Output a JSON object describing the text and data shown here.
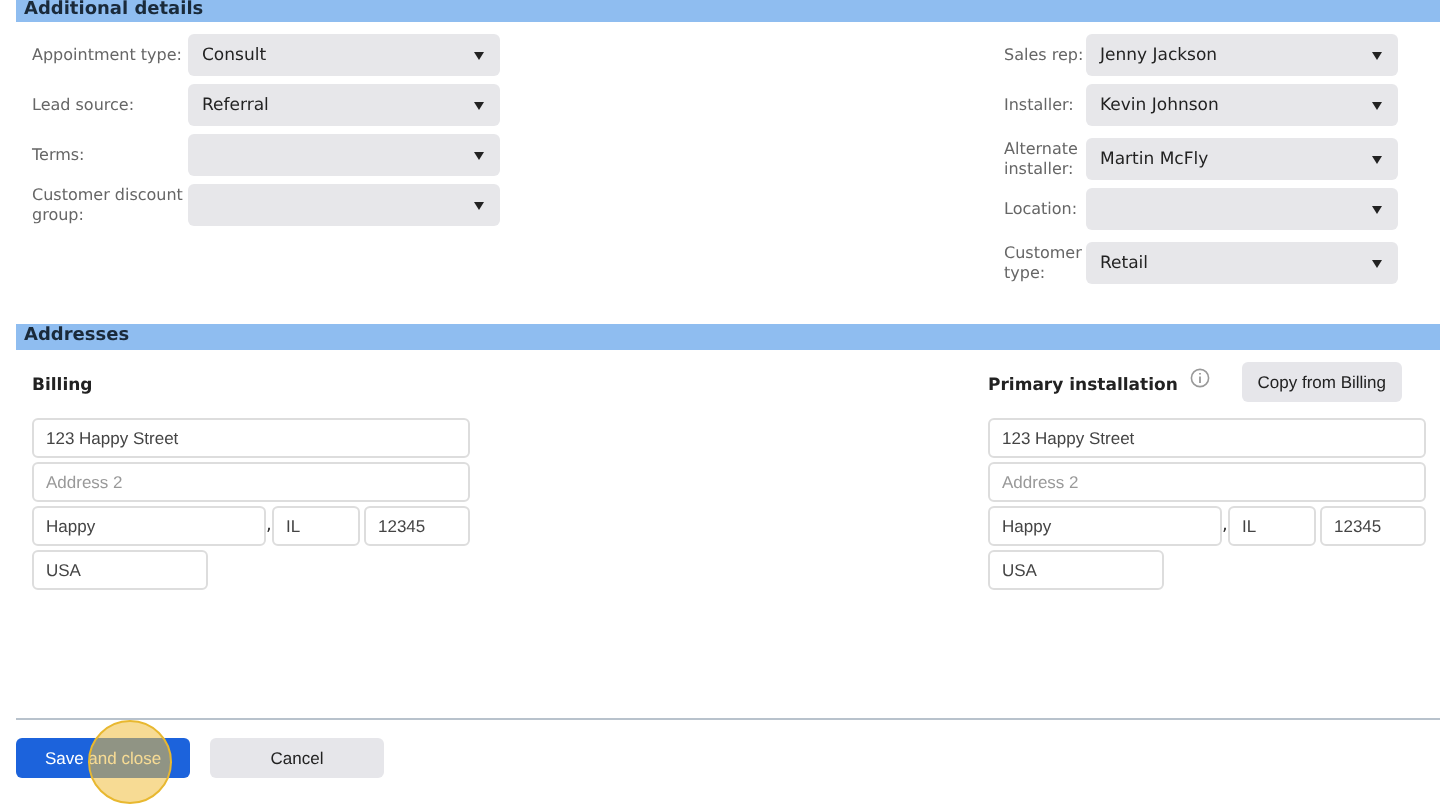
{
  "details_section": {
    "title": "Additional details",
    "left_fields": [
      {
        "label": "Appointment type:",
        "value": "Consult"
      },
      {
        "label": "Lead source:",
        "value": "Referral"
      },
      {
        "label": "Terms:"
      },
      {
        "label": "Customer discount group:"
      }
    ],
    "right_fields": [
      {
        "label": "Sales rep:",
        "value": "Jenny Jackson"
      },
      {
        "label": "Installer:",
        "value": "Kevin Johnson"
      },
      {
        "label": "Alternate installer:",
        "value": "Martin McFly"
      },
      {
        "label": "Location:"
      },
      {
        "label": "Customer type:",
        "value": "Retail"
      }
    ]
  },
  "addresses_section": {
    "title": "Addresses",
    "billing": {
      "title": "Billing",
      "street": "123 Happy Street",
      "address2_placeholder": "Address 2",
      "city": "Happy",
      "separator": ",",
      "state": "IL",
      "zip": "12345",
      "country": "USA"
    },
    "installation": {
      "title": "Primary installation",
      "copy_button": "Copy from Billing",
      "street": "123 Happy Street",
      "address2_placeholder": "Address 2",
      "city": "Happy",
      "separator": ",",
      "state": "IL",
      "zip": "12345",
      "country": "USA"
    }
  },
  "footer": {
    "buttons": [
      {
        "label": "Save and close",
        "kind": "primary"
      },
      {
        "label": "Cancel",
        "kind": "secondary"
      }
    ],
    "click_highlight": true
  }
}
